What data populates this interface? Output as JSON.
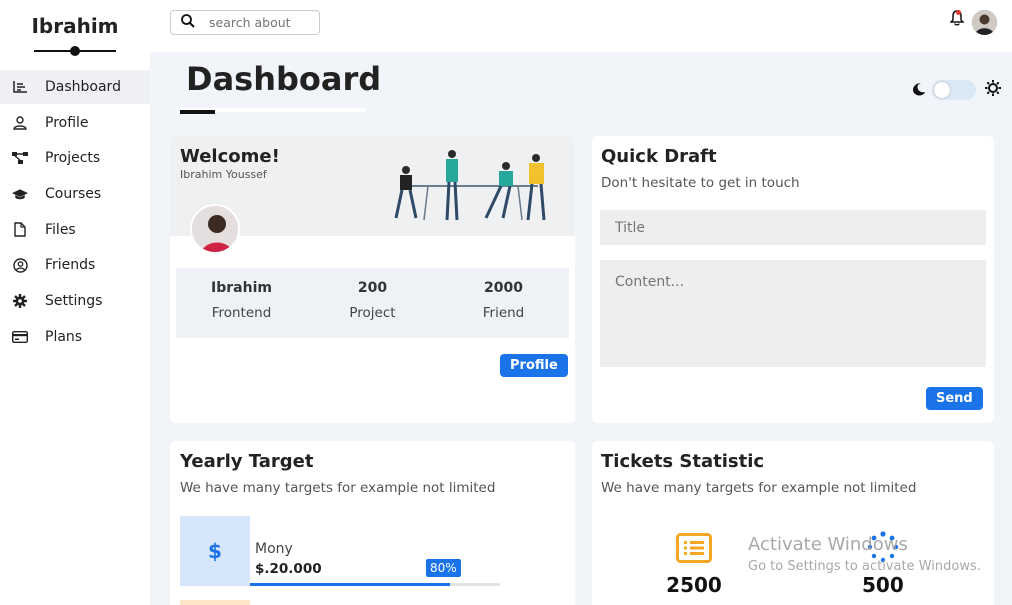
{
  "sidebar": {
    "brand": "Ibrahim",
    "items": [
      {
        "label": "Dashboard",
        "icon": "chart-icon",
        "active": true
      },
      {
        "label": "Profile",
        "icon": "user-icon"
      },
      {
        "label": "Projects",
        "icon": "diagram-icon"
      },
      {
        "label": "Courses",
        "icon": "graduation-cap-icon"
      },
      {
        "label": "Files",
        "icon": "file-icon"
      },
      {
        "label": "Friends",
        "icon": "user-circle-icon"
      },
      {
        "label": "Settings",
        "icon": "gear-icon"
      },
      {
        "label": "Plans",
        "icon": "credit-card-icon"
      }
    ]
  },
  "topbar": {
    "search_placeholder": "search about"
  },
  "page": {
    "title": "Dashboard"
  },
  "welcome": {
    "title": "Welcome!",
    "name": "Ibrahim Youssef",
    "stats": [
      {
        "value": "Ibrahim",
        "label": "Frontend"
      },
      {
        "value": "200",
        "label": "Project"
      },
      {
        "value": "2000",
        "label": "Friend"
      }
    ],
    "button": "Profile"
  },
  "draft": {
    "title": "Quick Draft",
    "subtitle": "Don't hesitate to get in touch",
    "title_placeholder": "Title",
    "content_placeholder": "Content...",
    "button": "Send"
  },
  "yearly": {
    "title": "Yearly Target",
    "subtitle": "We have many targets for example not limited",
    "money_icon": "$",
    "money_label": "Mony",
    "money_value": "$.20.000",
    "progress_label": "80%",
    "progress": 0.8
  },
  "tickets": {
    "title": "Tickets Statistic",
    "subtitle": "We have many targets for example not limited",
    "items": [
      {
        "value": "2500",
        "icon": "list-icon"
      },
      {
        "value": "500",
        "icon": "spinner-icon"
      }
    ]
  },
  "watermark": {
    "title": "Activate Windows",
    "subtitle": "Go to Settings to activate Windows."
  },
  "colors": {
    "accent": "#1a73e8",
    "background": "#f1f5f9",
    "ticket_orange": "#f5a623"
  }
}
